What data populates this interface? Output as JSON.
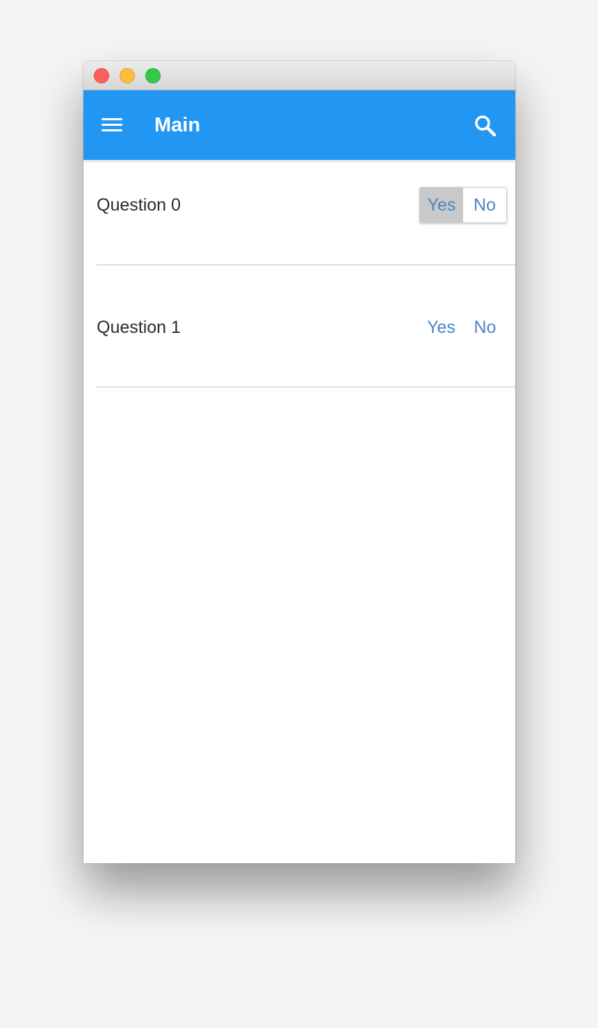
{
  "app": {
    "title": "Main",
    "accent_color": "#2196f3"
  },
  "window_controls": [
    "close",
    "minimize",
    "maximize"
  ],
  "icons": {
    "menu": "hamburger-menu-icon",
    "search": "search-icon"
  },
  "questions": [
    {
      "label": "Question 0",
      "yes_label": "Yes",
      "no_label": "No",
      "selected": "Yes"
    },
    {
      "label": "Question 1",
      "yes_label": "Yes",
      "no_label": "No",
      "selected": ""
    }
  ]
}
